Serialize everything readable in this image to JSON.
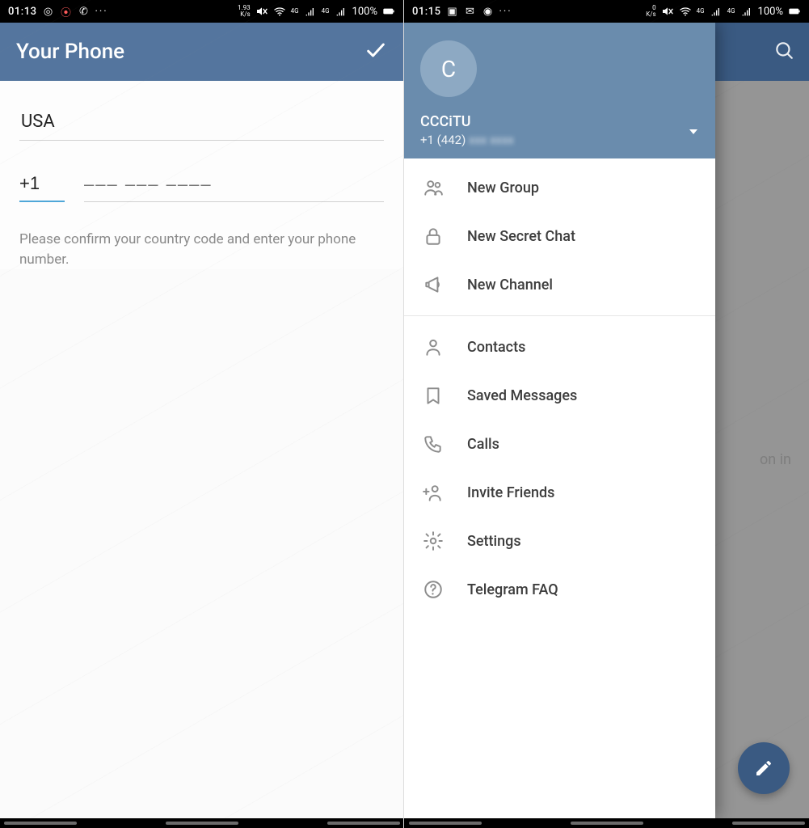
{
  "left": {
    "status": {
      "time": "01:13",
      "speed": "1.93\nK/s",
      "battery": "100%"
    },
    "appbar": {
      "title": "Your Phone"
    },
    "form": {
      "country": "USA",
      "code": "+1",
      "placeholder": "––– ––– ––––",
      "help": "Please confirm your country code and enter your phone number."
    }
  },
  "right": {
    "status": {
      "time": "01:15",
      "speed": "0\nK/s",
      "battery": "100%"
    },
    "bg": {
      "hint_fragment": "on in"
    },
    "drawer": {
      "avatar_initial": "C",
      "name": "CCCiTU",
      "phone_visible": "+1 (442)",
      "phone_hidden": "xxx xxxx",
      "groups": [
        [
          {
            "key": "new-group",
            "label": "New Group",
            "icon": "group"
          },
          {
            "key": "new-secret-chat",
            "label": "New Secret Chat",
            "icon": "lock"
          },
          {
            "key": "new-channel",
            "label": "New Channel",
            "icon": "megaphone"
          }
        ],
        [
          {
            "key": "contacts",
            "label": "Contacts",
            "icon": "person"
          },
          {
            "key": "saved-messages",
            "label": "Saved Messages",
            "icon": "bookmark"
          },
          {
            "key": "calls",
            "label": "Calls",
            "icon": "phone"
          },
          {
            "key": "invite-friends",
            "label": "Invite Friends",
            "icon": "person-plus"
          },
          {
            "key": "settings",
            "label": "Settings",
            "icon": "gear"
          },
          {
            "key": "telegram-faq",
            "label": "Telegram FAQ",
            "icon": "help"
          }
        ]
      ]
    }
  }
}
